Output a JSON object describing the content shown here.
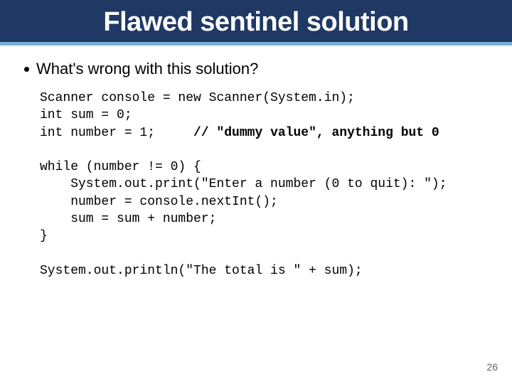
{
  "title": "Flawed sentinel solution",
  "bullet": "What's wrong with this solution?",
  "code": {
    "l1": "Scanner console = new Scanner(System.in);",
    "l2": "int sum = 0;",
    "l3a": "int number = 1;     ",
    "l3b": "// \"dummy value\", anything but 0",
    "blank1": "",
    "l4": "while (number != 0) {",
    "l5": "    System.out.print(\"Enter a number (0 to quit): \");",
    "l6": "    number = console.nextInt();",
    "l7": "    sum = sum + number;",
    "l8": "}",
    "blank2": "",
    "l9": "System.out.println(\"The total is \" + sum);"
  },
  "page_number": "26"
}
